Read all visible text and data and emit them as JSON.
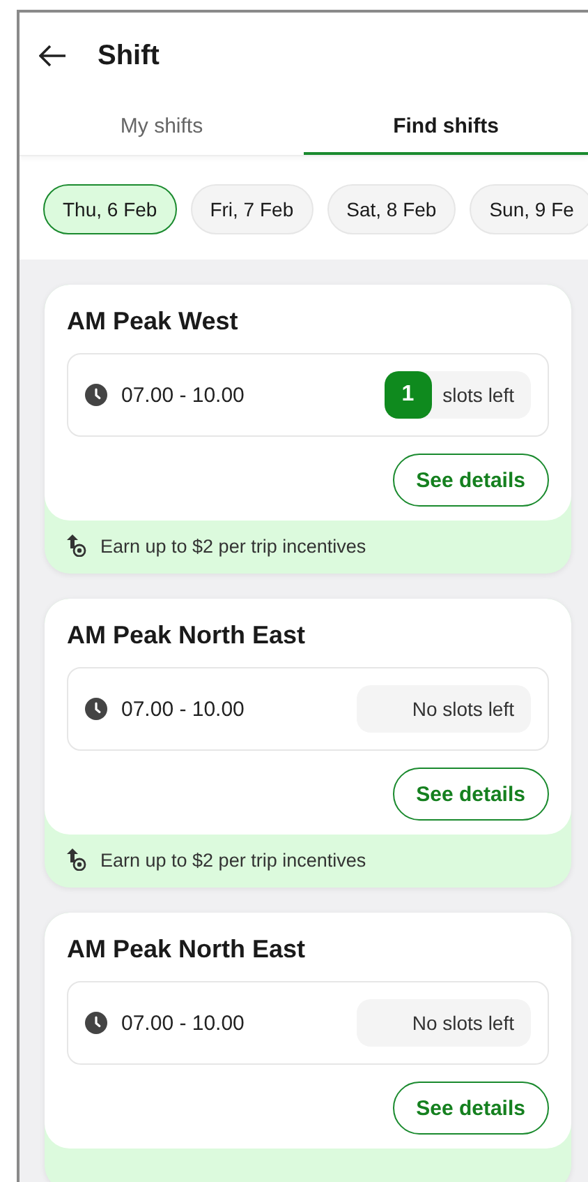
{
  "header": {
    "title": "Shift"
  },
  "tabs": [
    {
      "label": "My shifts",
      "selected": false
    },
    {
      "label": "Find shifts",
      "selected": true
    }
  ],
  "dates": [
    {
      "label": "Thu, 6 Feb",
      "selected": true
    },
    {
      "label": "Fri, 7 Feb",
      "selected": false
    },
    {
      "label": "Sat, 8 Feb",
      "selected": false
    },
    {
      "label": "Sun, 9 Fe",
      "selected": false
    }
  ],
  "shifts": [
    {
      "name": "AM Peak West",
      "time": "07.00 - 10.00",
      "slots": {
        "kind": "count",
        "count": "1",
        "label": "slots left"
      },
      "action": "See details",
      "incentive": "Earn up to $2 per trip incentives"
    },
    {
      "name": "AM Peak North East",
      "time": "07.00 - 10.00",
      "slots": {
        "kind": "none",
        "label": "No slots left"
      },
      "action": "See details",
      "incentive": "Earn up to $2 per trip incentives"
    },
    {
      "name": "AM Peak North East",
      "time": "07.00 - 10.00",
      "slots": {
        "kind": "none",
        "label": "No slots left"
      },
      "action": "See details"
    }
  ]
}
